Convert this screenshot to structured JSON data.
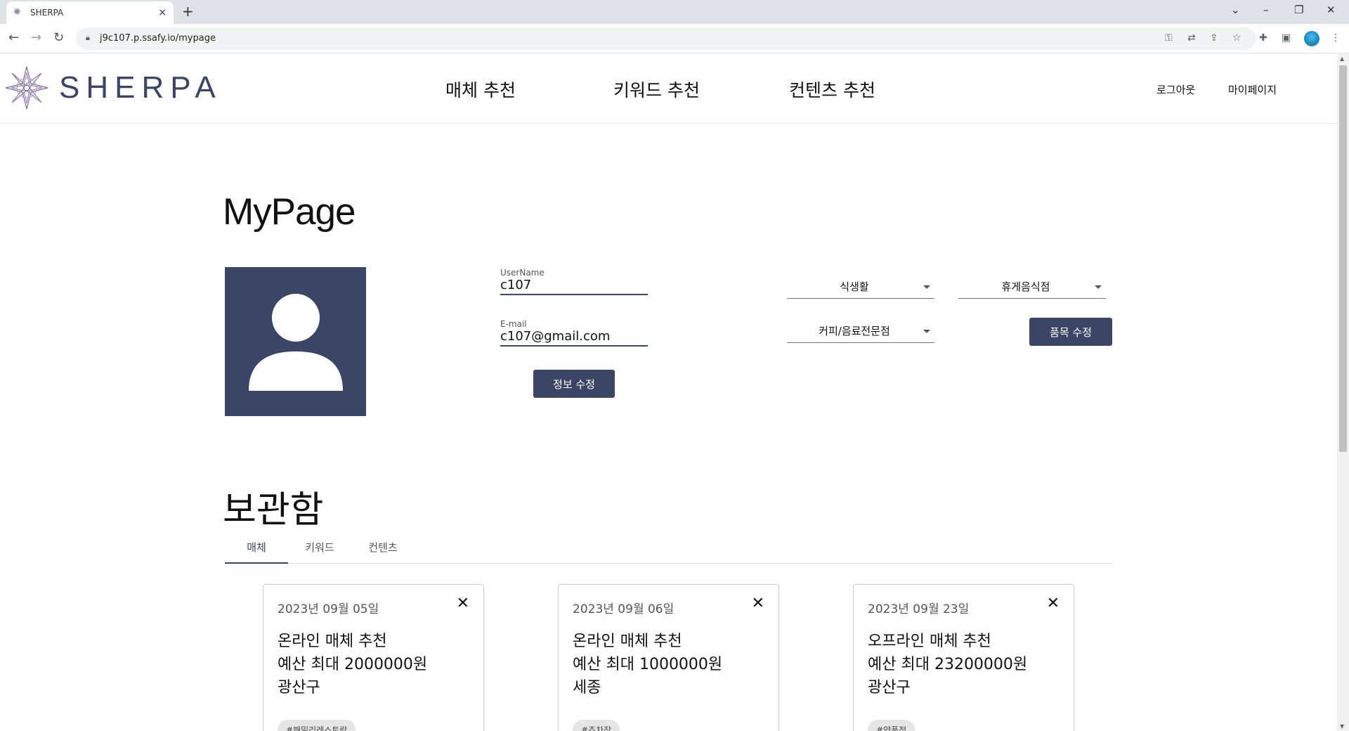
{
  "browser": {
    "tab_title": "SHERPA",
    "tab_close": "×",
    "new_tab": "+",
    "url": "j9c107.p.ssafy.io/mypage",
    "window_min": "⌄",
    "window_minimize": "–",
    "window_restore": "❐",
    "window_close": "✕"
  },
  "header": {
    "logo_text": "SHERPA",
    "nav": [
      "매체 추천",
      "키워드 추천",
      "컨텐츠 추천"
    ],
    "logout": "로그아웃",
    "mypage": "마이페이지"
  },
  "profile": {
    "title": "MyPage",
    "username_label": "UserName",
    "username_value": "c107",
    "email_label": "E-mail",
    "email_value": "c107@gmail.com",
    "edit_info_button": "정보 수정",
    "category_1": "식생활",
    "category_2": "휴게음식점",
    "category_3": "커피/음료전문점",
    "edit_category_button": "품목 수정"
  },
  "storage": {
    "title": "보관함",
    "tabs": [
      "매체",
      "키워드",
      "컨텐츠"
    ],
    "active_tab": "매체",
    "cards": [
      {
        "date": "2023년 09월 05일",
        "type": "온라인 매체 추천",
        "budget": "예산 최대 2000000원",
        "region": "광산구",
        "tag": "#패밀리레스토랑"
      },
      {
        "date": "2023년 09월 06일",
        "type": "온라인 매체 추천",
        "budget": "예산 최대 1000000원",
        "region": "세종",
        "tag": "#주차장"
      },
      {
        "date": "2023년 09월 23일",
        "type": "오프라인 매체 추천",
        "budget": "예산 최대 23200000원",
        "region": "광산구",
        "tag": "#약품점"
      }
    ],
    "close_symbol": "✕"
  },
  "colors": {
    "accent": "#3b4566",
    "tabbar": "#dee1e6"
  }
}
